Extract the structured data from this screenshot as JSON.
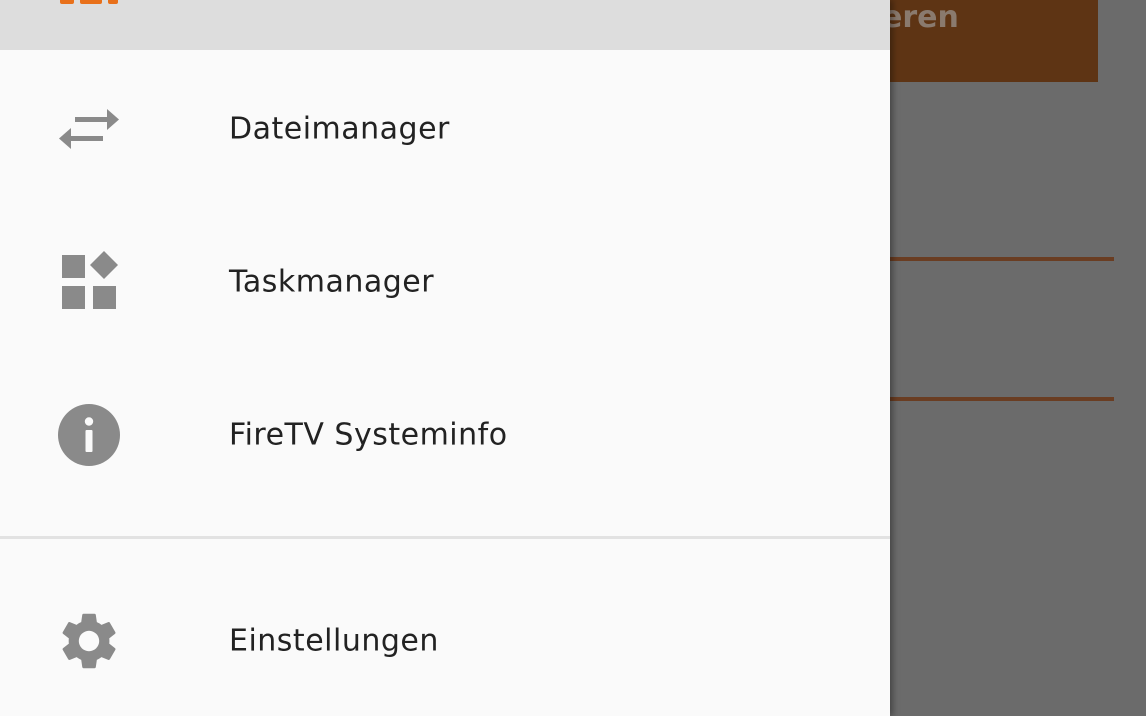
{
  "background": {
    "button_label": "eren"
  },
  "drawer": {
    "items": [
      {
        "label": "Dateimanager",
        "icon": "swap-arrows-icon"
      },
      {
        "label": "Taskmanager",
        "icon": "apps-widgets-icon"
      },
      {
        "label": "FireTV Systeminfo",
        "icon": "info-icon"
      }
    ],
    "footer_items": [
      {
        "label": "Einstellungen",
        "icon": "gear-icon"
      }
    ]
  },
  "colors": {
    "accent": "#e8701a",
    "brand_brown": "#5e3414",
    "icon_gray": "#8a8a8a",
    "drawer_bg": "#fafafa"
  }
}
